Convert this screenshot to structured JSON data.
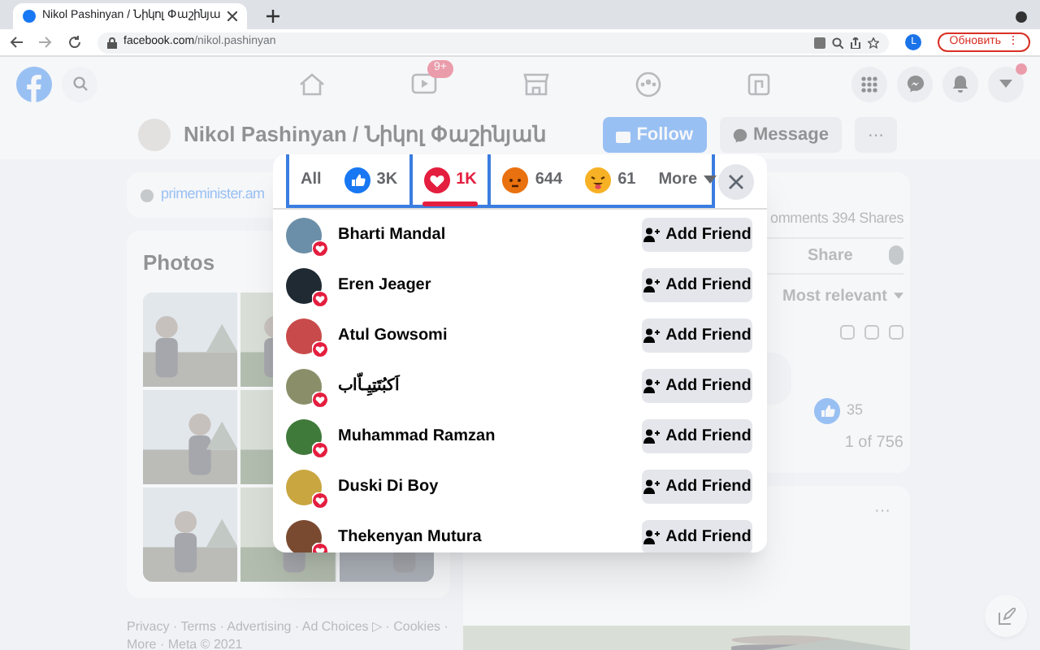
{
  "browser": {
    "tab_title": "Nikol Pashinyan / Նիկոլ Փաշինյա",
    "url_host": "facebook.com",
    "url_path": "/nikol.pashinyan",
    "profile_initial": "L",
    "update_button": "Обновить",
    "update_menu": "⋮"
  },
  "nav": {
    "video_badge": "9+",
    "menu_dot": true
  },
  "profile": {
    "name": "Nikol Pashinyan / Նիկոլ Փաշինյան",
    "follow": "Follow",
    "message": "Message",
    "more": "···"
  },
  "left": {
    "website": "primeminister.am",
    "photos_title": "Photos",
    "footer_1": "Privacy · Terms · Advertising · Ad Choices ▷ · Cookies ·",
    "footer_2": "More · Meta © 2021"
  },
  "right": {
    "counts": "omments 394 Shares",
    "share": "Share",
    "sort": "Most relevant",
    "reaction_count": "35",
    "pager": "1 of 756",
    "post_more": "···"
  },
  "reactions_dialog": {
    "tabs": [
      {
        "kind": "all",
        "label": "All",
        "selected": false
      },
      {
        "kind": "like",
        "label": "3K",
        "selected": false
      },
      {
        "kind": "love",
        "label": "1K",
        "selected": true
      },
      {
        "kind": "angry",
        "label": "644",
        "selected": false
      },
      {
        "kind": "tongue",
        "label": "61",
        "selected": false
      },
      {
        "kind": "more",
        "label": "More",
        "selected": false
      }
    ],
    "people": [
      {
        "name": "Bharti Mandal",
        "action": "Add Friend"
      },
      {
        "name": "Eren Jeager",
        "action": "Add Friend"
      },
      {
        "name": "Atul Gowsomi",
        "action": "Add Friend"
      },
      {
        "name": "اَكبُتَتِيِـاّاب",
        "action": "Add Friend"
      },
      {
        "name": "Muhammad Ramzan",
        "action": "Add Friend"
      },
      {
        "name": "Duski Di Boy",
        "action": "Add Friend"
      },
      {
        "name": "Thekenyan Mutura",
        "action": "Add Friend"
      }
    ]
  }
}
